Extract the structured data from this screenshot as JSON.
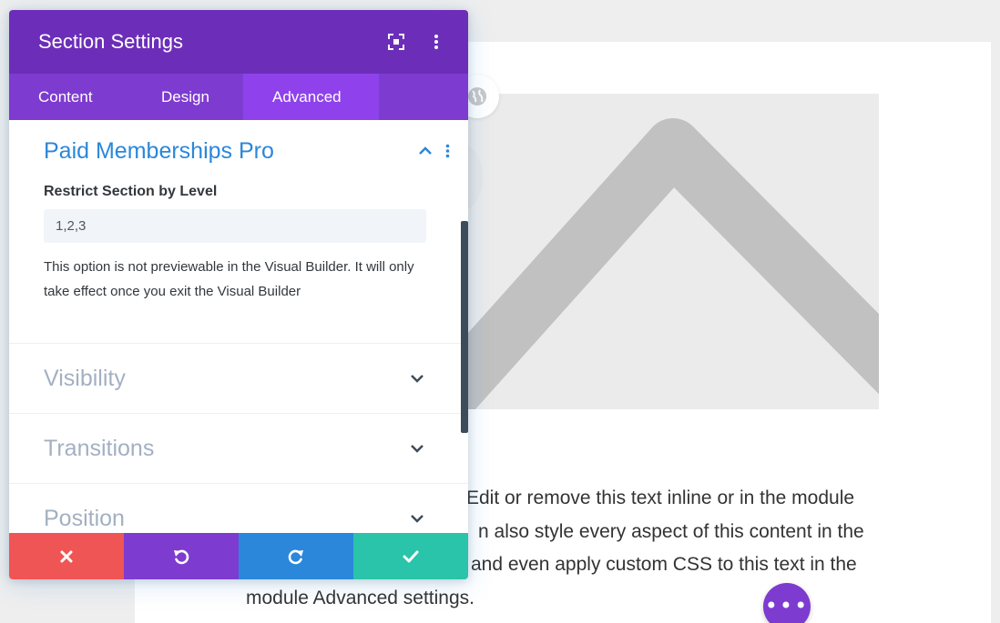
{
  "modal": {
    "title": "Section Settings",
    "tabs": [
      {
        "label": "Content",
        "active": false
      },
      {
        "label": "Design",
        "active": false
      },
      {
        "label": "Advanced",
        "active": true
      }
    ],
    "groups": {
      "pmp": {
        "title": "Paid Memberships Pro",
        "field_label": "Restrict Section by Level",
        "field_value": "1,2,3",
        "help_text": "This option is not previewable in the Visual Builder. It will only take effect once you exit the Visual Builder"
      },
      "visibility": {
        "title": "Visibility"
      },
      "transitions": {
        "title": "Transitions"
      },
      "position": {
        "title": "Position"
      }
    },
    "actions": {
      "discard": "close-icon",
      "undo": "undo-icon",
      "redo": "redo-icon",
      "save": "check-icon"
    }
  },
  "background": {
    "text_lines": [
      "Edit or remove this text inline or in the module",
      "n also style every aspect of this content in the",
      "and even apply custom CSS to this text in the",
      "module Advanced settings."
    ]
  },
  "colors": {
    "header": "#6c2eb9",
    "tabs": "#7e3bd0",
    "tab_active": "#8f42ec",
    "accent_blue": "#2b87da",
    "discard": "#ef5555",
    "save": "#29c4a9"
  }
}
